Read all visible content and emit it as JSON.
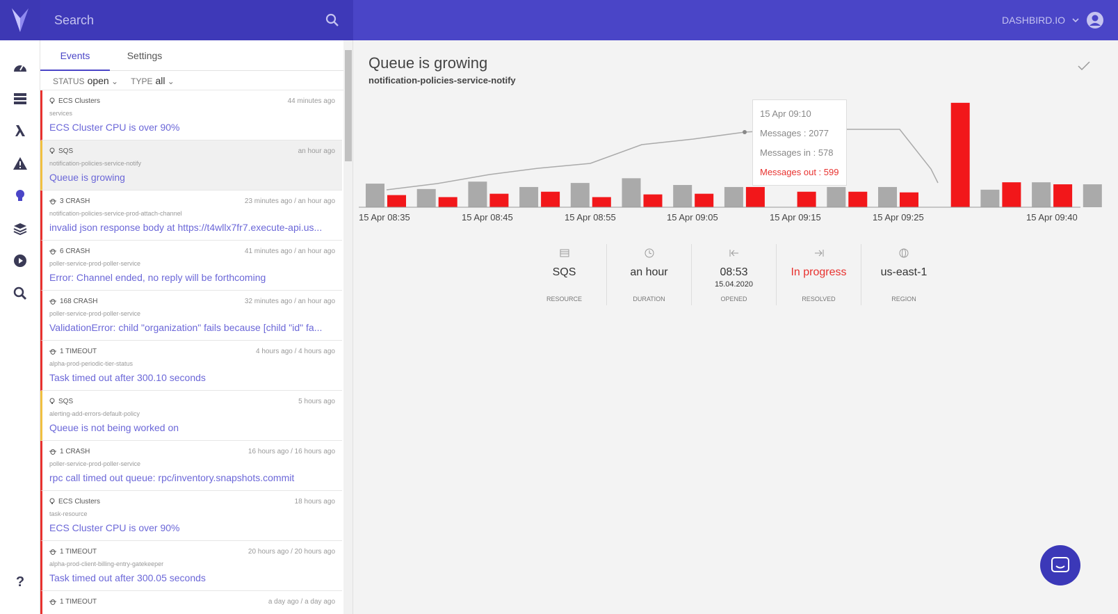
{
  "topbar": {
    "search_placeholder": "Search",
    "account_name": "DASHBIRD.IO"
  },
  "sidebar": {
    "items": [
      "dashboard-icon",
      "server-icon",
      "lambda-icon",
      "warning-icon",
      "bulb-icon",
      "layers-icon",
      "play-icon",
      "search-icon"
    ],
    "help": "?"
  },
  "panel": {
    "tabs": [
      {
        "label": "Events"
      },
      {
        "label": "Settings"
      }
    ],
    "filters": {
      "status_label": "STATUS",
      "status_value": "open",
      "type_label": "TYPE",
      "type_value": "all"
    },
    "events": [
      {
        "type": "ECS Clusters",
        "when": "44 minutes ago",
        "sub": "services",
        "title": "ECS Cluster CPU is over 90%",
        "level": "error"
      },
      {
        "type": "SQS",
        "when": "an hour ago",
        "sub": "notification-policies-service-notify",
        "title": "Queue is growing",
        "level": "warn"
      },
      {
        "type": "3 CRASH",
        "when": "23 minutes ago / an hour ago",
        "sub": "notification-policies-service-prod-attach-channel",
        "title": "invalid json response body at https://t4wllx7fr7.execute-api.us...",
        "level": "error"
      },
      {
        "type": "6 CRASH",
        "when": "41 minutes ago / an hour ago",
        "sub": "poller-service-prod-poller-service",
        "title": "Error: Channel ended, no reply will be forthcoming",
        "level": "error"
      },
      {
        "type": "168 CRASH",
        "when": "32 minutes ago / an hour ago",
        "sub": "poller-service-prod-poller-service",
        "title": "ValidationError: child \"organization\" fails because [child \"id\" fa...",
        "level": "error"
      },
      {
        "type": "1 TIMEOUT",
        "when": "4 hours ago / 4 hours ago",
        "sub": "alpha-prod-periodic-tier-status",
        "title": "Task timed out after 300.10 seconds",
        "level": "error"
      },
      {
        "type": "SQS",
        "when": "5 hours ago",
        "sub": "alerting-add-errors-default-policy",
        "title": "Queue is not being worked on",
        "level": "warn"
      },
      {
        "type": "1 CRASH",
        "when": "16 hours ago / 16 hours ago",
        "sub": "poller-service-prod-poller-service",
        "title": "rpc call timed out queue: rpc/inventory.snapshots.commit",
        "level": "error"
      },
      {
        "type": "ECS Clusters",
        "when": "18 hours ago",
        "sub": "task-resource",
        "title": "ECS Cluster CPU is over 90%",
        "level": "error"
      },
      {
        "type": "1 TIMEOUT",
        "when": "20 hours ago / 20 hours ago",
        "sub": "alpha-prod-client-billing-entry-gatekeeper",
        "title": "Task timed out after 300.05 seconds",
        "level": "error"
      },
      {
        "type": "1 TIMEOUT",
        "when": "a day ago / a day ago",
        "sub": "",
        "title": "",
        "level": "error"
      }
    ]
  },
  "detail": {
    "title": "Queue is growing",
    "subtitle": "notification-policies-service-notify",
    "stats": [
      {
        "icon": "list-icon",
        "value": "SQS",
        "date": "",
        "label": "RESOURCE",
        "red": false
      },
      {
        "icon": "clock-icon",
        "value": "an hour",
        "date": "",
        "label": "DURATION",
        "red": false
      },
      {
        "icon": "arrow-left-bar-icon",
        "value": "08:53",
        "date": "15.04.2020",
        "label": "OPENED",
        "red": false
      },
      {
        "icon": "arrow-right-bar-icon",
        "value": "In progress",
        "date": "",
        "label": "RESOLVED",
        "red": true
      },
      {
        "icon": "globe-icon",
        "value": "us-east-1",
        "date": "",
        "label": "REGION",
        "red": false
      }
    ],
    "tooltip": {
      "time": "15 Apr 09:10",
      "messages": "Messages : 2077",
      "messages_in": "Messages in : 578",
      "messages_out": "Messages out : 599"
    }
  },
  "chart_data": {
    "type": "bar",
    "x_ticks": [
      "15 Apr 08:35",
      "15 Apr 08:45",
      "15 Apr 08:55",
      "15 Apr 09:05",
      "15 Apr 09:15",
      "15 Apr 09:25",
      "15 Apr 09:40"
    ],
    "series": [
      {
        "name": "Messages in",
        "color": "#aaaaaa",
        "values": [
          35,
          27,
          38,
          30,
          36,
          43,
          33,
          30,
          0,
          30,
          30,
          0,
          26,
          37,
          34,
          11
        ]
      },
      {
        "name": "Messages out",
        "color": "#f2171a",
        "values": [
          18,
          15,
          20,
          23,
          15,
          19,
          20,
          30,
          23,
          23,
          22,
          155,
          37,
          34,
          0,
          10
        ]
      },
      {
        "name": "Messages",
        "color": "#aaaaaa",
        "type": "line",
        "values": [
          25,
          35,
          45,
          55,
          62,
          90,
          100,
          110,
          112,
          112,
          112,
          112,
          40
        ]
      }
    ],
    "ylim": [
      0,
      160
    ]
  }
}
